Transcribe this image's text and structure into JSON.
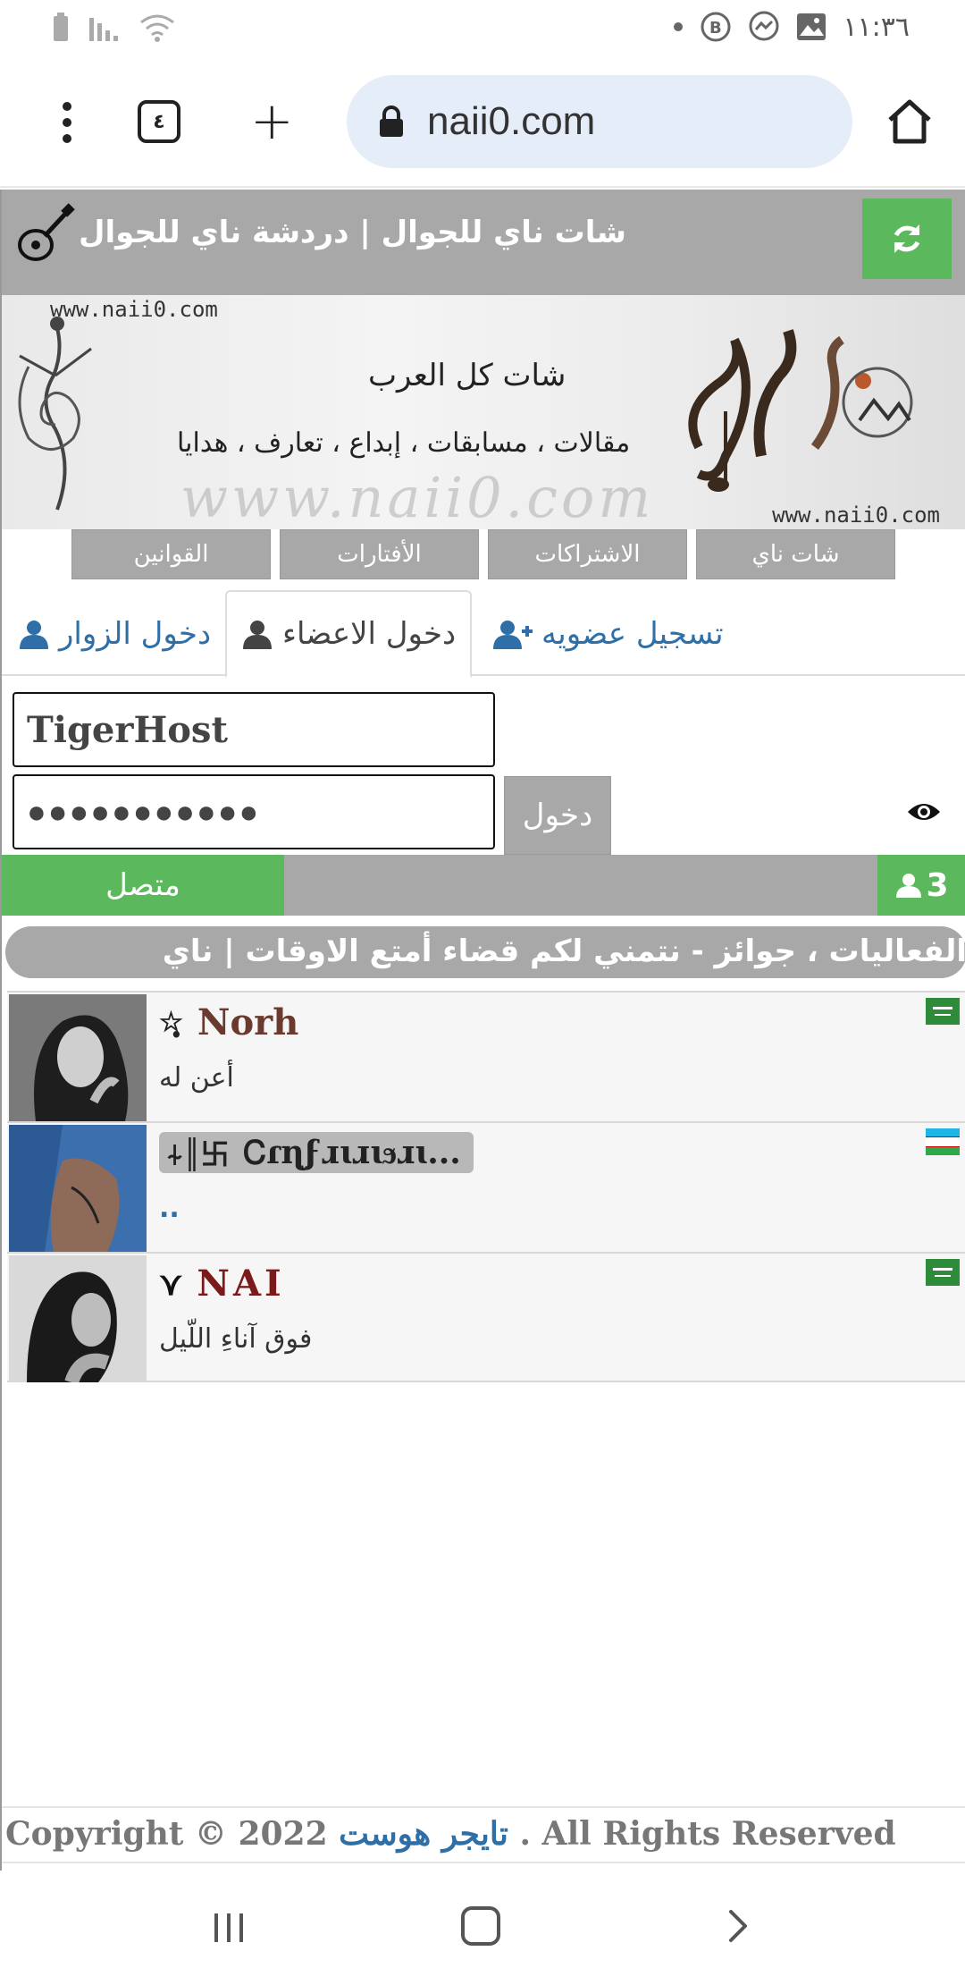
{
  "status_bar": {
    "time": "١١:٣٦",
    "icons": [
      "battery-icon",
      "signal-icon",
      "wifi-icon",
      "dot-icon",
      "b-icon",
      "messenger-icon",
      "image-icon"
    ]
  },
  "browser": {
    "tab_count": "٤",
    "url": "naii0.com"
  },
  "header": {
    "title": "شات ناي للجوال | دردشة ناي للجوال"
  },
  "banner": {
    "url_top": "www.naii0.com",
    "url_bottom": "www.naii0.com",
    "watermark": "www.naii0.com",
    "slogan": "شات كل العرب",
    "tagline": "مقالات ، مسابقات ، إبداع ، تعارف ، هدايا"
  },
  "nav": [
    {
      "label": "شات ناي"
    },
    {
      "label": "الاشتراكات"
    },
    {
      "label": "الأفتارات"
    },
    {
      "label": "القوانين"
    }
  ],
  "auth_tabs": {
    "register": "تسجيل عضويه",
    "members": "دخول الاعضاء",
    "visitors": "دخول الزوار"
  },
  "login": {
    "username": "TigerHost",
    "password": "●●●●●●●●●●●",
    "submit": "دخول"
  },
  "status": {
    "online": "متصل",
    "count": "3"
  },
  "marquee": {
    "text": "الفعاليات ، جوائز - نتمني لكم قضاء أمتع الاوقات | ناي"
  },
  "users": [
    {
      "prefix": "☆̣̥",
      "name": "Norh",
      "status": "أعن له",
      "name_color": "#6b3a2e",
      "flag": "sa"
    },
    {
      "prefix": "⍭║卐",
      "name": "Ꮯɾɳϝɹɩɹɩϧɹɩ...",
      "status": "..",
      "name_color": "#222222",
      "flag": "uz"
    },
    {
      "prefix": "⋎",
      "name": "NAI",
      "status": "فوق آناءِ اللّيل",
      "name_color": "#7a1a1a",
      "flag": "sa"
    }
  ],
  "footer": {
    "pre": "Copyright © 2022 ",
    "brand": "تايجر هوست",
    "post": " . All Rights Reserved"
  },
  "colors": {
    "accent_green": "#5cb85c",
    "bar_gray": "#a8a8a8",
    "link_blue": "#2f6fa8"
  }
}
